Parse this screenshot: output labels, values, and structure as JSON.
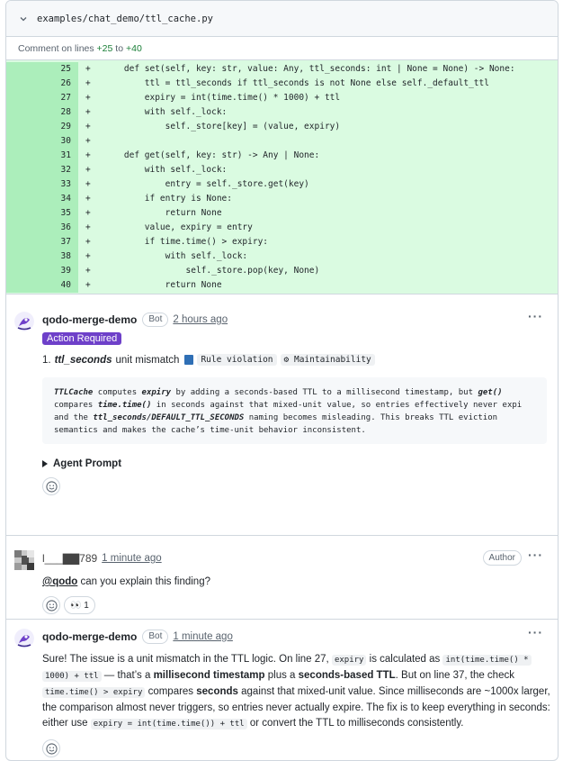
{
  "file": {
    "path": "examples/chat_demo/ttl_cache.py"
  },
  "comment_range": {
    "prefix": "Comment on lines",
    "start": "+25",
    "to": "to",
    "end": "+40"
  },
  "code_lines": [
    {
      "n": "25",
      "s": "+",
      "t": "    def set(self, key: str, value: Any, ttl_seconds: int | None = None) -> None:"
    },
    {
      "n": "26",
      "s": "+",
      "t": "        ttl = ttl_seconds if ttl_seconds is not None else self._default_ttl"
    },
    {
      "n": "27",
      "s": "+",
      "t": "        expiry = int(time.time() * 1000) + ttl"
    },
    {
      "n": "28",
      "s": "+",
      "t": "        with self._lock:"
    },
    {
      "n": "29",
      "s": "+",
      "t": "            self._store[key] = (value, expiry)"
    },
    {
      "n": "30",
      "s": "+",
      "t": ""
    },
    {
      "n": "31",
      "s": "+",
      "t": "    def get(self, key: str) -> Any | None:"
    },
    {
      "n": "32",
      "s": "+",
      "t": "        with self._lock:"
    },
    {
      "n": "33",
      "s": "+",
      "t": "            entry = self._store.get(key)"
    },
    {
      "n": "34",
      "s": "+",
      "t": "        if entry is None:"
    },
    {
      "n": "35",
      "s": "+",
      "t": "            return None"
    },
    {
      "n": "36",
      "s": "+",
      "t": "        value, expiry = entry"
    },
    {
      "n": "37",
      "s": "+",
      "t": "        if time.time() > expiry:"
    },
    {
      "n": "38",
      "s": "+",
      "t": "            with self._lock:"
    },
    {
      "n": "39",
      "s": "+",
      "t": "                self._store.pop(key, None)"
    },
    {
      "n": "40",
      "s": "+",
      "t": "            return None"
    }
  ],
  "comment1": {
    "author": "qodo-merge-demo",
    "bot_badge": "Bot",
    "time": "2 hours ago",
    "label": "Action Required",
    "finding_num": "1.",
    "finding_name": "ttl_seconds",
    "finding_rest": "unit mismatch",
    "tag1": "Rule violation",
    "tag2": "⚙ Maintainability",
    "explain": {
      "l1a": "TTLCache",
      "l1b": " computes ",
      "l1c": "expiry",
      "l1d": " by adding a seconds-based TTL to a millisecond timestamp, but ",
      "l1e": "get()",
      "l2a": "compares ",
      "l2b": "time.time()",
      "l2c": " in seconds against that mixed-unit value, so entries effectively never expi",
      "l3a": "and the ",
      "l3b": "ttl_seconds/DEFAULT_TTL_SECONDS",
      "l3c": " naming becomes misleading. This breaks TTL eviction",
      "l4": "semantics and makes the cache’s time-unit behavior inconsistent."
    },
    "agent_prompt": "Agent Prompt"
  },
  "comment2": {
    "author": "l___▇▇789",
    "time": "1 minute ago",
    "author_badge": "Author",
    "mention": "@qodo",
    "text": " can you explain this finding?",
    "reaction_emoji": "👀",
    "reaction_count": "1"
  },
  "comment3": {
    "author": "qodo-merge-demo",
    "bot_badge": "Bot",
    "time": "1 minute ago",
    "p1": "Sure! The issue is a unit mismatch in the TTL logic. On line 27, ",
    "c1": "expiry",
    "p2": " is calculated as ",
    "c2": "int(time.time() *",
    "c3": "1000) + ttl",
    "p3": " — that’s a ",
    "b1": "millisecond timestamp",
    "p4": " plus a ",
    "b2": "seconds-based TTL",
    "p5": ". But on line 37, the check",
    "c4": "time.time() > expiry",
    "p6": " compares ",
    "b3": "seconds",
    "p7": " against that mixed-unit value. Since milliseconds are ~1000x larger, the comparison almost never triggers, so entries never actually expire. The fix is to keep everything in seconds: either use ",
    "c5": "expiry = int(time.time()) + ttl",
    "p8": " or convert the TTL to milliseconds consistently."
  }
}
